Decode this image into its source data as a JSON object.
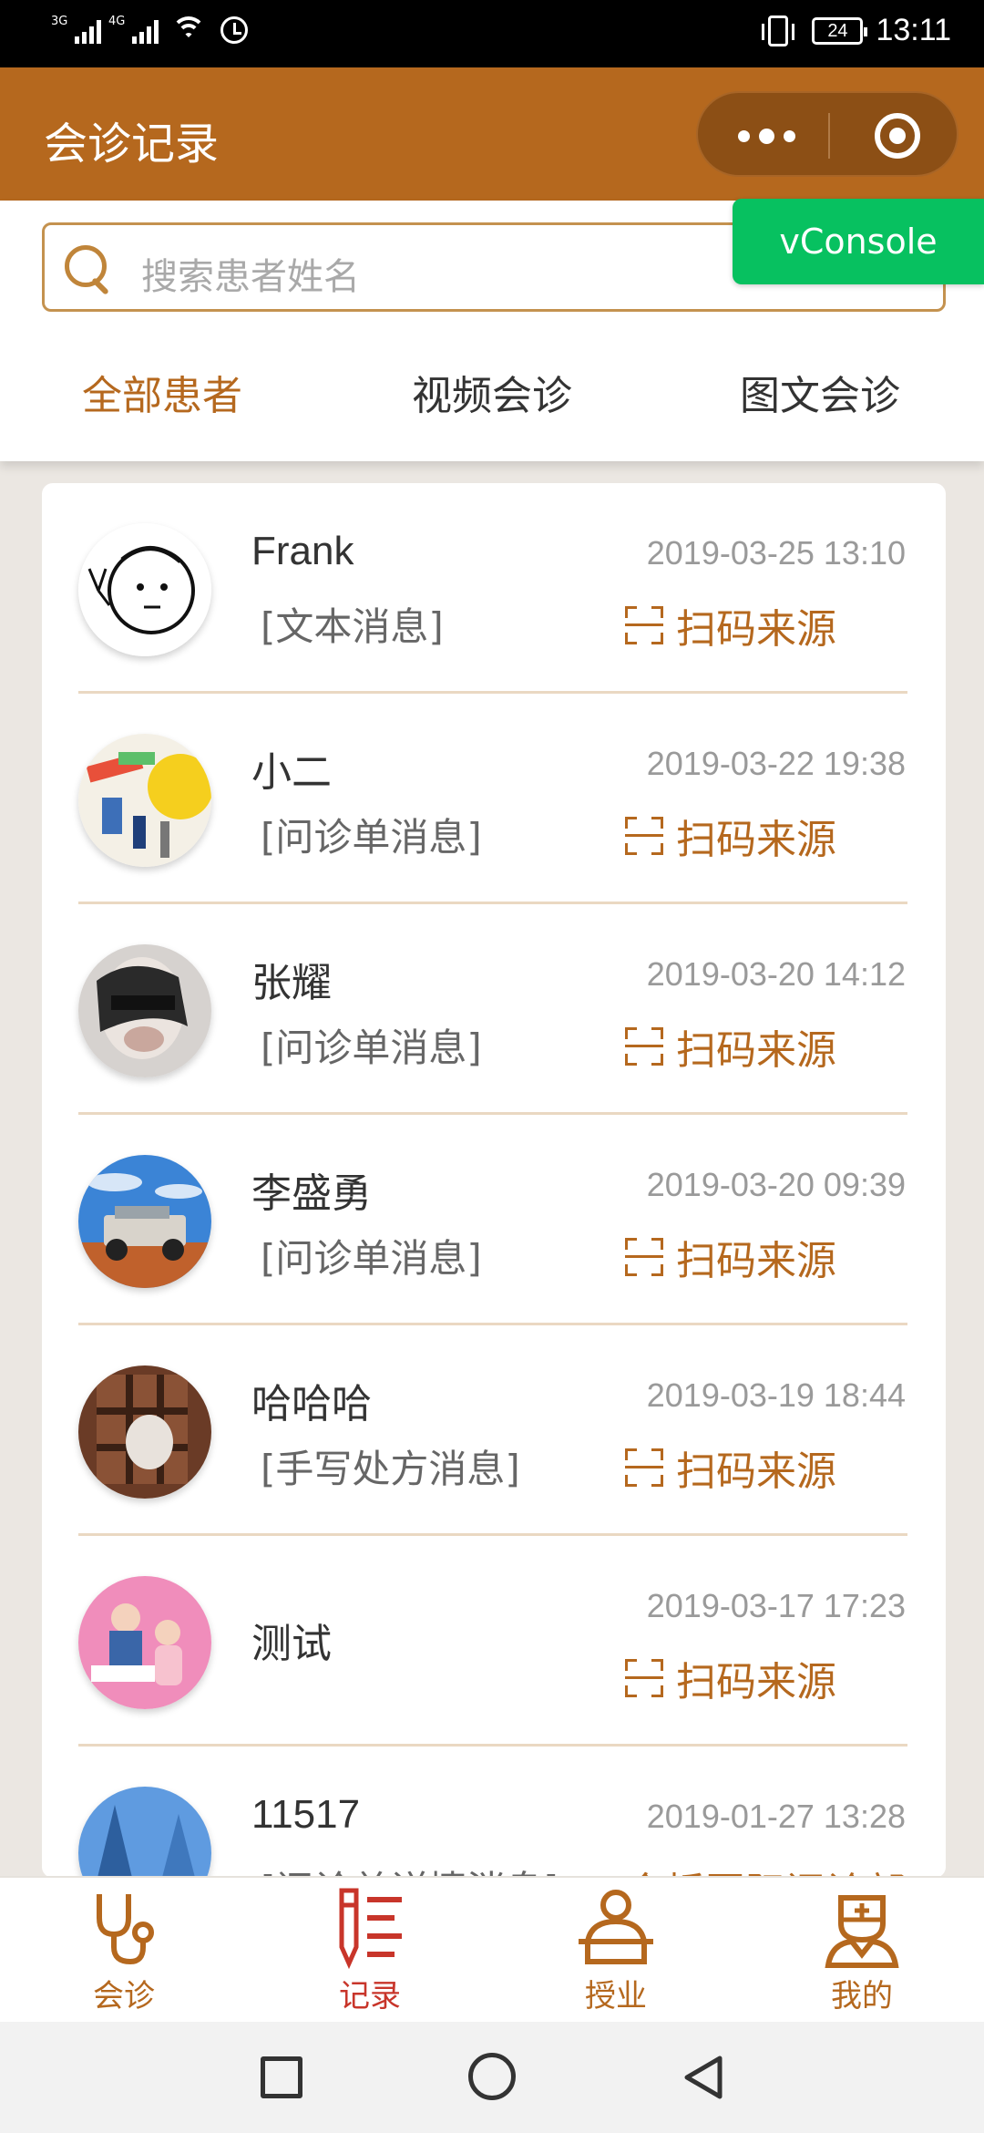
{
  "status_bar": {
    "net1": "3G",
    "net2": "4G",
    "battery": "24",
    "time": "13:11"
  },
  "header": {
    "title": "会诊记录"
  },
  "vconsole_label": "vConsole",
  "search": {
    "placeholder": "搜索患者姓名"
  },
  "tabs": [
    {
      "label": "全部患者",
      "active": true
    },
    {
      "label": "视频会诊",
      "active": false
    },
    {
      "label": "图文会诊",
      "active": false
    }
  ],
  "records": [
    {
      "name": "Frank",
      "message": "[文本消息]",
      "time": "2019-03-25 13:10",
      "source": "扫码来源"
    },
    {
      "name": "小二",
      "message": "[问诊单消息]",
      "time": "2019-03-22 19:38",
      "source": "扫码来源"
    },
    {
      "name": "张耀",
      "message": "[问诊单消息]",
      "time": "2019-03-20 14:12",
      "source": "扫码来源"
    },
    {
      "name": "李盛勇",
      "message": "[问诊单消息]",
      "time": "2019-03-20 09:39",
      "source": "扫码来源"
    },
    {
      "name": "哈哈哈",
      "message": "[手写处方消息]",
      "time": "2019-03-19 18:44",
      "source": "扫码来源"
    },
    {
      "name": "测试",
      "message": "",
      "time": "2019-03-17 17:23",
      "source": "扫码来源"
    },
    {
      "name": "11517",
      "message": "[问诊单详情消息]",
      "time": "2019-01-27 13:28",
      "source": "金桥国际问诊部"
    }
  ],
  "tab_bar": [
    {
      "label": "会诊",
      "icon": "stethoscope-icon",
      "active": false
    },
    {
      "label": "记录",
      "icon": "record-list-icon",
      "active": true
    },
    {
      "label": "授业",
      "icon": "teacher-icon",
      "active": false
    },
    {
      "label": "我的",
      "icon": "doctor-icon",
      "active": false
    }
  ],
  "colors": {
    "brand": "#b5681e",
    "active_tab_bar": "#c8352a",
    "vconsole": "#07c160"
  }
}
